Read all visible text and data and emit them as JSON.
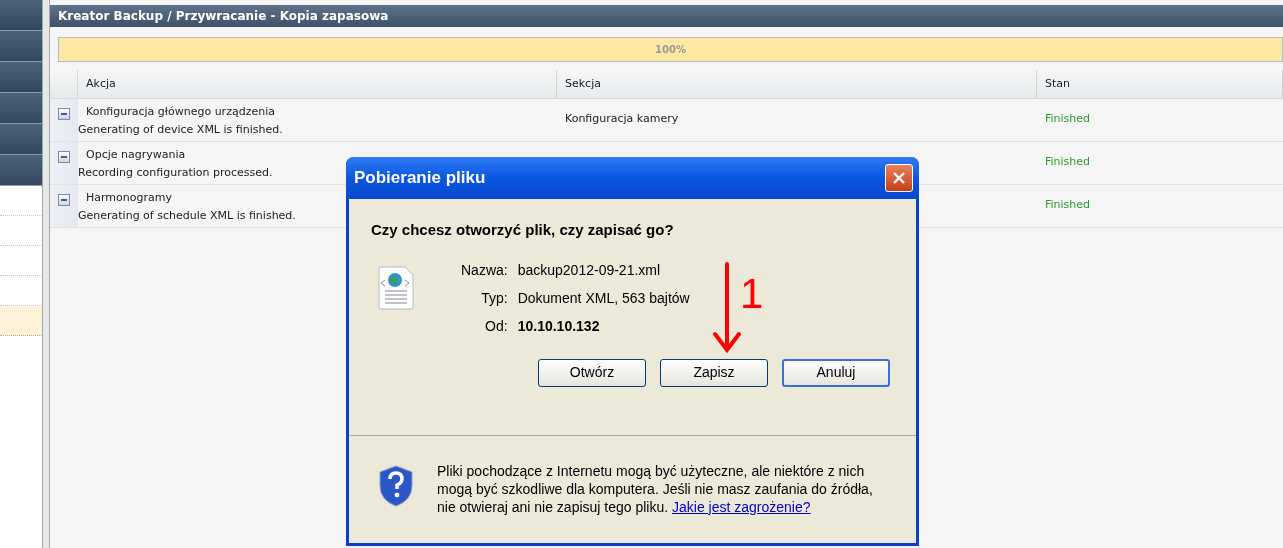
{
  "sidebar": {
    "items": [
      {
        "kind": "dark",
        "selected": false
      },
      {
        "kind": "dark",
        "selected": false
      },
      {
        "kind": "dark",
        "selected": false
      },
      {
        "kind": "dark",
        "selected": false
      },
      {
        "kind": "dark",
        "selected": false
      },
      {
        "kind": "dark",
        "selected": false
      },
      {
        "kind": "light",
        "selected": false
      },
      {
        "kind": "light",
        "selected": false
      },
      {
        "kind": "light",
        "selected": false
      },
      {
        "kind": "light",
        "selected": false
      },
      {
        "kind": "light",
        "selected": true
      }
    ]
  },
  "panel": {
    "title": "Kreator Backup / Przywracanie - Kopia zapasowa"
  },
  "progress": {
    "level": 1,
    "reading": "100%"
  },
  "table": {
    "columns": [
      "Akcja",
      "Sekcja",
      "Stan"
    ],
    "rows": [
      {
        "expanded": true,
        "action": "Konfiguracja głównego urządzenia",
        "detail": "Generating of device XML is finished.",
        "section": "Konfiguracja kamery",
        "status": "Finished"
      },
      {
        "expanded": true,
        "action": "Opcje nagrywania",
        "detail": "Recording configuration processed.",
        "status": "Finished"
      },
      {
        "expanded": true,
        "action": "Harmonogramy",
        "detail": "Generating of schedule XML is finished.",
        "status": "Finished"
      }
    ]
  },
  "dialog": {
    "title": "Pobieranie pliku",
    "question": "Czy chcesz otworzyć plik, czy zapisać go?",
    "fields": [
      {
        "label": "Nazwa:",
        "value": "backup2012-09-21.xml",
        "bold": false
      },
      {
        "label": "Typ:",
        "value": "Dokument XML, 563 bajtów",
        "bold": false
      },
      {
        "label": "Od:",
        "value": "10.10.10.132",
        "bold": true
      }
    ],
    "buttons": [
      {
        "label": "Otwórz",
        "default": false
      },
      {
        "label": "Zapisz",
        "default": false
      },
      {
        "label": "Anuluj",
        "default": true
      }
    ],
    "warning": "Pliki pochodzące z Internetu mogą być użyteczne, ale niektóre z nich mogą być szkodliwe dla komputera. Jeśli nie masz zaufania do źródła, nie otwieraj ani nie zapisuj tego pliku.",
    "link": "Jakie jest zagrożenie?"
  },
  "annotation": {
    "label": "1"
  }
}
